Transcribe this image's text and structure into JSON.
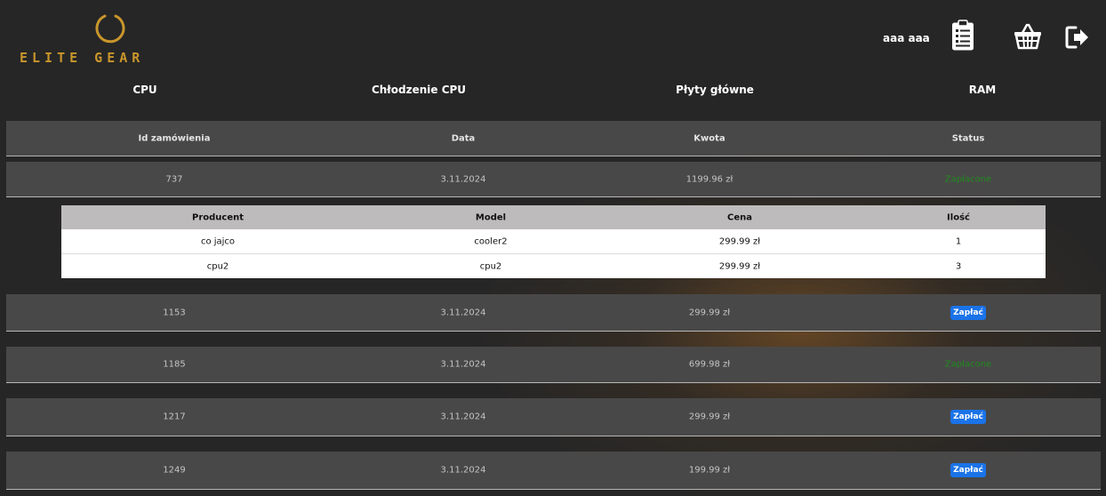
{
  "brand": {
    "logo_text": "ELITE GEAR",
    "accent_color": "#c9962c"
  },
  "header": {
    "user_name": "aaa aaa",
    "icons": [
      "orders-clipboard-icon",
      "basket-icon",
      "logout-icon"
    ]
  },
  "nav": {
    "items": [
      {
        "label": "CPU"
      },
      {
        "label": "Chłodzenie CPU"
      },
      {
        "label": "Płyty główne"
      },
      {
        "label": "RAM"
      }
    ]
  },
  "orders": {
    "columns": [
      "Id zamówienia",
      "Data",
      "Kwota",
      "Status"
    ],
    "rows": [
      {
        "id": "737",
        "date": "3.11.2024",
        "amount": "1199.96 zł",
        "status": "Zapłacone",
        "status_type": "paid"
      },
      {
        "id": "1153",
        "date": "3.11.2024",
        "amount": "299.99 zł",
        "status": "Zapłać",
        "status_type": "button"
      },
      {
        "id": "1185",
        "date": "3.11.2024",
        "amount": "699.98 zł",
        "status": "Zapłacone",
        "status_type": "paid"
      },
      {
        "id": "1217",
        "date": "3.11.2024",
        "amount": "299.99 zł",
        "status": "Zapłać",
        "status_type": "button"
      },
      {
        "id": "1249",
        "date": "3.11.2024",
        "amount": "199.99 zł",
        "status": "Zapłać",
        "status_type": "button"
      }
    ]
  },
  "order_details": {
    "columns": [
      "Producent",
      "Model",
      "Cena",
      "Ilość"
    ],
    "rows": [
      {
        "producer": "co jajco",
        "model": "cooler2",
        "price": "299.99 zł",
        "qty": "1"
      },
      {
        "producer": "cpu2",
        "model": "cpu2",
        "price": "299.99 zł",
        "qty": "3"
      }
    ]
  },
  "colors": {
    "background": "#262626",
    "row_band": "#494848",
    "paid_status": "#1f8a1f",
    "pay_button": "#1a73e8"
  }
}
